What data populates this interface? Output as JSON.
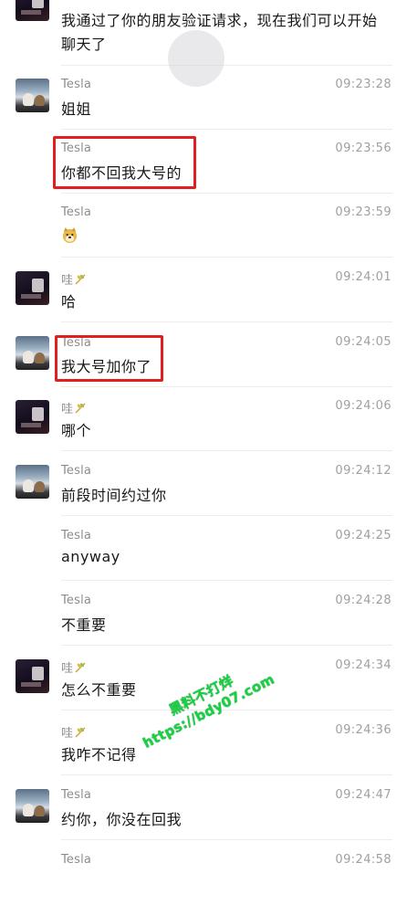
{
  "messages": [
    {
      "sender": "",
      "time": "",
      "text": "我通过了你的朋友验证请求，现在我们可以开始",
      "text2": "聊天了",
      "avatar": "wa-avatar"
    },
    {
      "sender": "Tesla",
      "time": "09:23:28",
      "text": "姐姐",
      "avatar": "tesla-avatar"
    },
    {
      "sender": "Tesla",
      "time": "09:23:56",
      "text": "你都不回我大号的",
      "avatar": ""
    },
    {
      "sender": "Tesla",
      "time": "09:23:59",
      "text": "",
      "emoji": "doge-emoji",
      "avatar": ""
    },
    {
      "sender": "哇",
      "time": "09:24:01",
      "text": "哈",
      "avatar": "wa-avatar"
    },
    {
      "sender": "Tesla",
      "time": "09:24:05",
      "text": "我大号加你了",
      "avatar": "tesla-avatar"
    },
    {
      "sender": "哇",
      "time": "09:24:06",
      "text": "哪个",
      "avatar": "wa-avatar"
    },
    {
      "sender": "Tesla",
      "time": "09:24:12",
      "text": "前段时间约过你",
      "avatar": "tesla-avatar"
    },
    {
      "sender": "Tesla",
      "time": "09:24:25",
      "text": "anyway",
      "avatar": ""
    },
    {
      "sender": "Tesla",
      "time": "09:24:28",
      "text": "不重要",
      "avatar": ""
    },
    {
      "sender": "哇",
      "time": "09:24:34",
      "text": "怎么不重要",
      "avatar": "wa-avatar"
    },
    {
      "sender": "哇",
      "time": "09:24:36",
      "text": "我咋不记得",
      "avatar": ""
    },
    {
      "sender": "Tesla",
      "time": "09:24:47",
      "text": "约你，你没在回我",
      "avatar": "tesla-avatar"
    },
    {
      "sender": "Tesla",
      "time": "09:24:58",
      "text": "",
      "avatar": ""
    }
  ],
  "watermark": {
    "line1": "黑料不打烊",
    "line2": "https://bdy07.com"
  },
  "colors": {
    "highlight": "#e02020",
    "watermark": "#12d63e",
    "timestamp": "#a0a0a0",
    "sender": "#8c8c8c"
  }
}
